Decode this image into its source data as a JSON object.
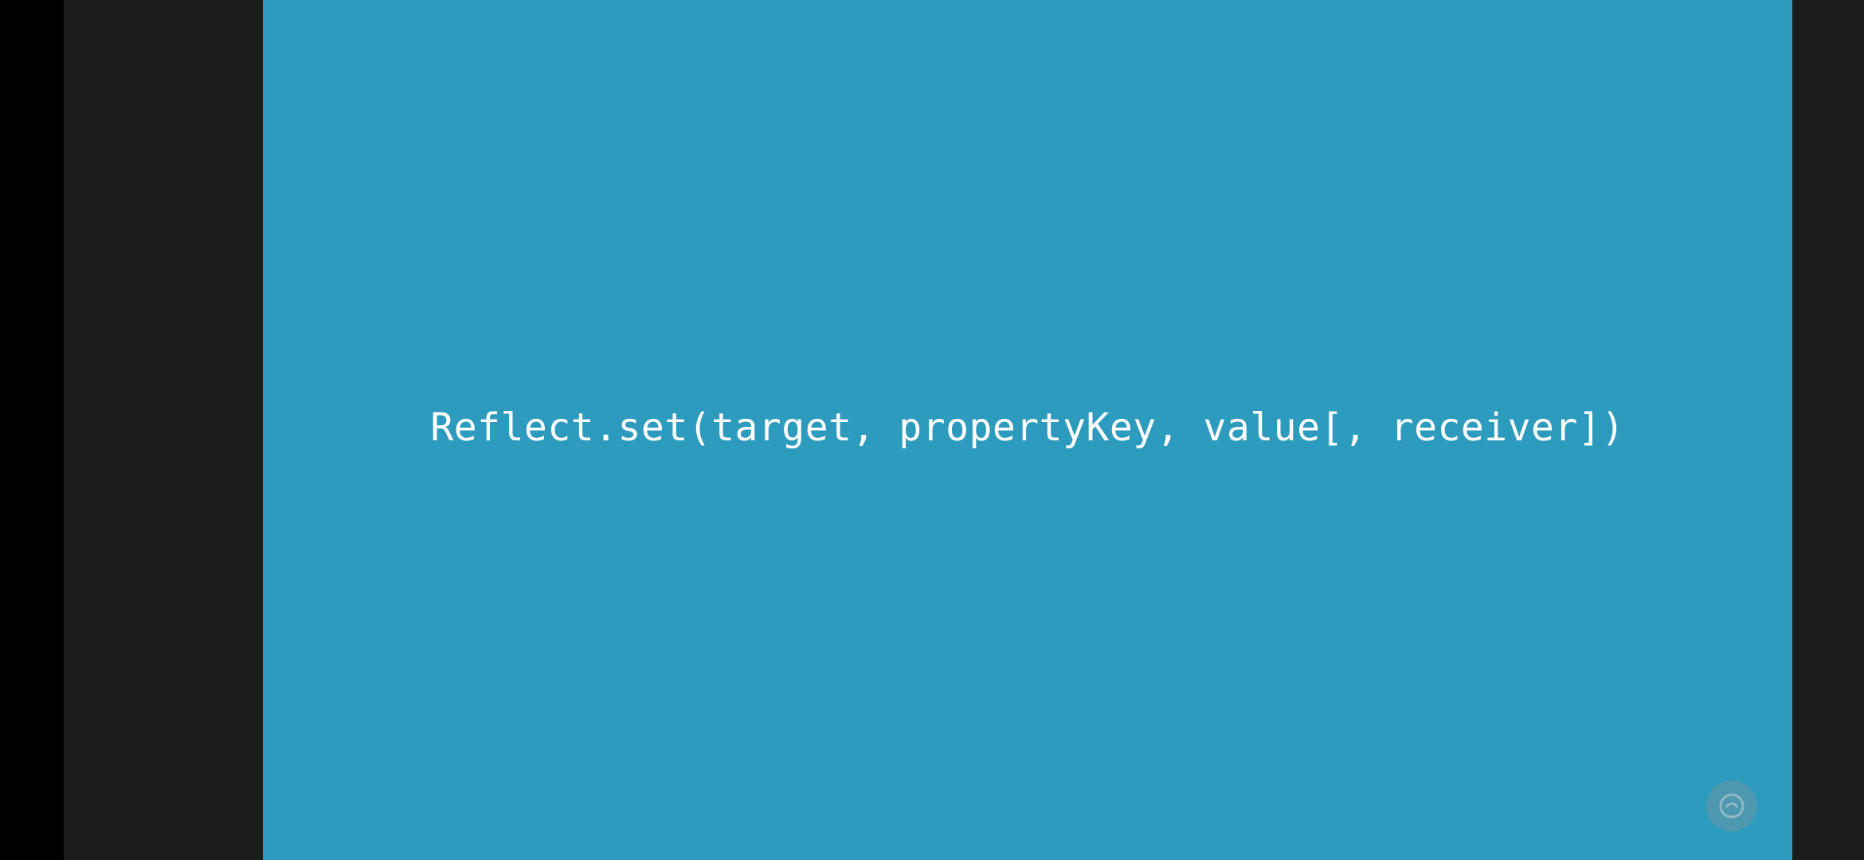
{
  "slide": {
    "code": "Reflect.set(target, propertyKey, value[, receiver])",
    "background_color": "#2d9bbd",
    "text_color": "#ffffff"
  },
  "player": {
    "letterbox_color": "#1b1b1b",
    "watermark_icon": "logo-watermark-icon"
  }
}
